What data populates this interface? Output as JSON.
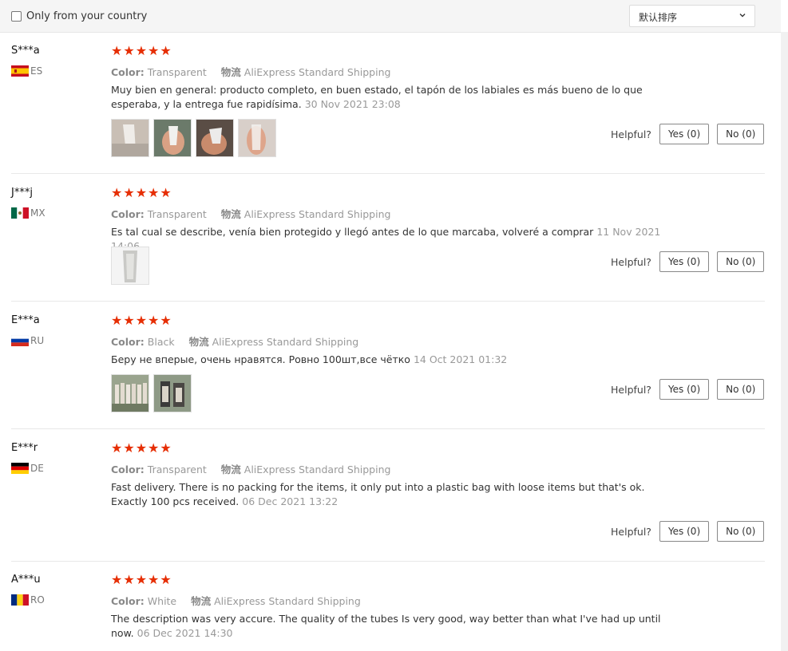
{
  "filter": {
    "only_country_label": "Only from your country"
  },
  "sort": {
    "selected": "默认排序"
  },
  "labels": {
    "color_key": "Color:",
    "shipping_key": "物流",
    "helpful": "Helpful?",
    "stars": "★★★★★"
  },
  "reviews": [
    {
      "user": "S***a",
      "country": "ES",
      "rating": 5,
      "color": "Transparent",
      "shipping": "AliExpress Standard Shipping",
      "text": "Muy bien en general: producto completo, en buen estado, el tapón de los labiales es más bueno de lo que esperaba, y la entrega fue rapidísima.",
      "date": "30 Nov 2021 23:08",
      "photos": 4,
      "yes": "Yes (0)",
      "no": "No (0)"
    },
    {
      "user": "J***j",
      "country": "MX",
      "rating": 5,
      "color": "Transparent",
      "shipping": "AliExpress Standard Shipping",
      "text": "Es tal cual se describe, venía bien protegido y llegó antes de lo que marcaba, volveré a comprar",
      "date": "11 Nov 2021 14:06",
      "photos": 1,
      "yes": "Yes (0)",
      "no": "No (0)"
    },
    {
      "user": "E***a",
      "country": "RU",
      "rating": 5,
      "color": "Black",
      "shipping": "AliExpress Standard Shipping",
      "text": "Беру не вперые, очень нравятся. Ровно 100шт,все чётко",
      "date": "14 Oct 2021 01:32",
      "photos": 2,
      "yes": "Yes (0)",
      "no": "No (0)"
    },
    {
      "user": "E***r",
      "country": "DE",
      "rating": 5,
      "color": "Transparent",
      "shipping": "AliExpress Standard Shipping",
      "text": "Fast delivery. There is no packing for the items, it only put into a plastic bag with loose items but that's ok. Exactly 100 pcs received.",
      "date": "06 Dec 2021 13:22",
      "photos": 0,
      "yes": "Yes (0)",
      "no": "No (0)"
    },
    {
      "user": "A***u",
      "country": "RO",
      "rating": 5,
      "color": "White",
      "shipping": "AliExpress Standard Shipping",
      "text": "The description was very accure. The quality of the tubes Is very good, way better than what I've had up until now.",
      "date": "06 Dec 2021 14:30",
      "photos": 0
    }
  ]
}
